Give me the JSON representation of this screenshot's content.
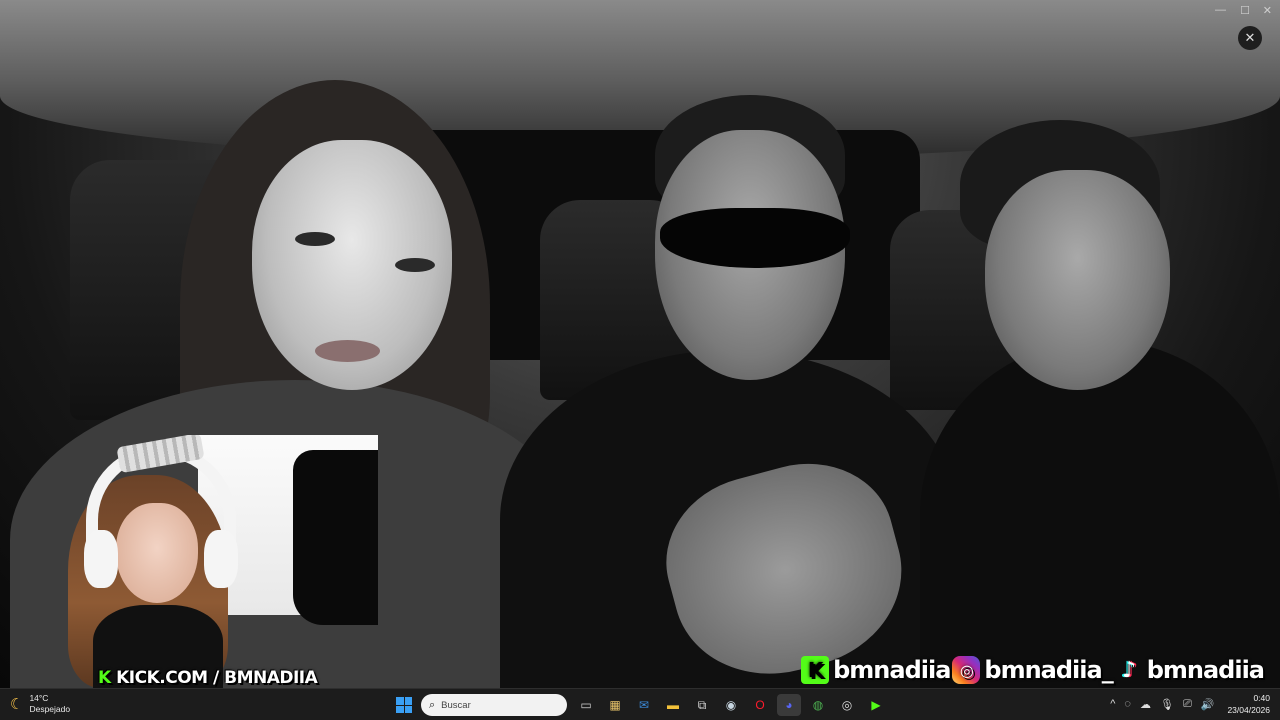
{
  "window": {
    "minimize": "—",
    "maximize": "☐",
    "close": "✕",
    "viewer_close": "✕"
  },
  "overlay": {
    "kick_label": "KICK.COM / BMNADIIA",
    "kick_letter": "K",
    "socials": [
      {
        "platform": "kick",
        "icon": "kick-icon",
        "glyph": "K",
        "handle": "bmnadiia"
      },
      {
        "platform": "instagram",
        "icon": "instagram-icon",
        "glyph": "◎",
        "handle": "bmnadiia_"
      },
      {
        "platform": "tiktok",
        "icon": "tiktok-icon",
        "glyph": "♪",
        "handle": "bmnadiia"
      }
    ]
  },
  "taskbar": {
    "weather_temp": "14°C",
    "weather_desc": "Despejado",
    "search_placeholder": "Buscar",
    "apps": [
      {
        "name": "task-view-icon",
        "glyph": "▭",
        "color": "#cfcfcf"
      },
      {
        "name": "store-icon",
        "glyph": "▦",
        "color": "#e9c46a"
      },
      {
        "name": "outlook-icon",
        "glyph": "✉",
        "color": "#3b8ad9"
      },
      {
        "name": "file-explorer-icon",
        "glyph": "▬",
        "color": "#f3c13a"
      },
      {
        "name": "capture-icon",
        "glyph": "⧉",
        "color": "#dddddd"
      },
      {
        "name": "steam-icon",
        "glyph": "◉",
        "color": "#c7d5e0"
      },
      {
        "name": "opera-icon",
        "glyph": "O",
        "color": "#ff1b2d"
      },
      {
        "name": "discord-icon",
        "glyph": "◕",
        "color": "#5865f2"
      },
      {
        "name": "chrome-icon",
        "glyph": "◍",
        "color": "#4caf50"
      },
      {
        "name": "obs-icon",
        "glyph": "◎",
        "color": "#dddddd"
      },
      {
        "name": "kick-app-icon",
        "glyph": "▶",
        "color": "#53fc18"
      }
    ],
    "tray_chevron": "^",
    "tray_icons": [
      "◌",
      "☁",
      "🎙",
      "⎚",
      "🔊"
    ],
    "time": "0:40",
    "date": "23/04/2026"
  }
}
